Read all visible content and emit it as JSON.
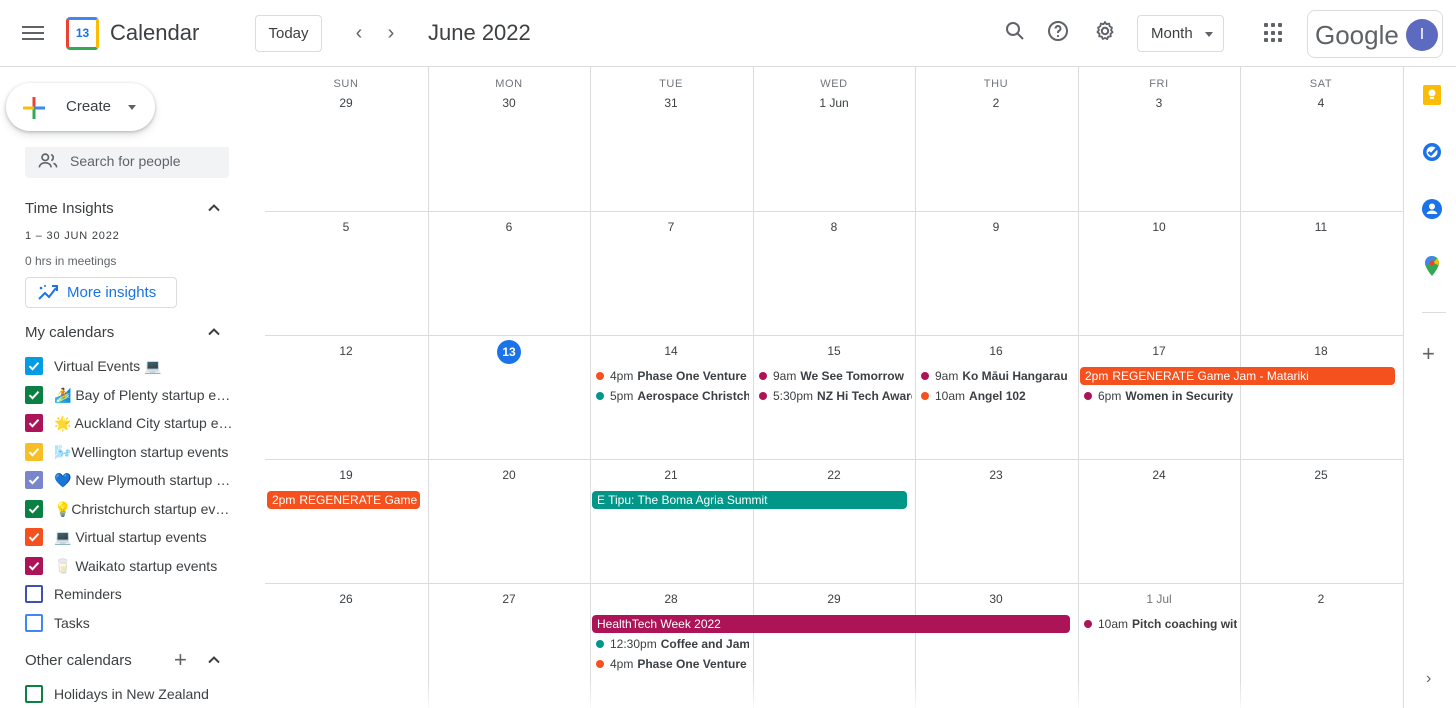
{
  "header": {
    "app_title": "Calendar",
    "logo_day": "13",
    "today_label": "Today",
    "prev_icon": "‹",
    "next_icon": "›",
    "month_title": "June 2022",
    "view_label": "Month",
    "brand": "Google",
    "avatar_initial": "I"
  },
  "sidebar": {
    "create_label": "Create",
    "search_people_placeholder": "Search for people",
    "time_insights": {
      "heading": "Time Insights",
      "date_range": "1 – 30 JUN 2022",
      "meetings": "0 hrs in meetings",
      "more_insights": "More insights"
    },
    "my_calendars_heading": "My calendars",
    "my_calendars": [
      {
        "label": "Virtual Events 💻",
        "color": "#039be5",
        "checked": true
      },
      {
        "label": "🏄 Bay of Plenty startup events",
        "color": "#0b8043",
        "checked": true
      },
      {
        "label": "🌟 Auckland City startup events",
        "color": "#ad1457",
        "checked": true
      },
      {
        "label": "🌬️Wellington startup events",
        "color": "#f6bf26",
        "checked": true
      },
      {
        "label": "💙 New Plymouth startup events",
        "color": "#7986cb",
        "checked": true
      },
      {
        "label": "💡Christchurch startup events",
        "color": "#0b8043",
        "checked": true
      },
      {
        "label": "💻 Virtual startup events",
        "color": "#f4511e",
        "checked": true
      },
      {
        "label": "🥛 Waikato startup events",
        "color": "#ad1457",
        "checked": true
      },
      {
        "label": "Reminders",
        "color": "#3f51b5",
        "checked": false
      },
      {
        "label": "Tasks",
        "color": "#4285f4",
        "checked": false
      }
    ],
    "other_calendars_heading": "Other calendars",
    "other_calendars": [
      {
        "label": "Holidays in New Zealand",
        "color": "#0b8043",
        "checked": false
      }
    ]
  },
  "calendar": {
    "weekdays": [
      "SUN",
      "MON",
      "TUE",
      "WED",
      "THU",
      "FRI",
      "SAT"
    ],
    "weeks": [
      [
        "29",
        "30",
        "31",
        "1 Jun",
        "2",
        "3",
        "4"
      ],
      [
        "5",
        "6",
        "7",
        "8",
        "9",
        "10",
        "11"
      ],
      [
        "12",
        "13",
        "14",
        "15",
        "16",
        "17",
        "18"
      ],
      [
        "19",
        "20",
        "21",
        "22",
        "23",
        "24",
        "25"
      ],
      [
        "26",
        "27",
        "28",
        "29",
        "30",
        "1 Jul",
        "2"
      ]
    ],
    "today": {
      "week": 2,
      "day": 1
    },
    "timed_events": [
      {
        "week": 2,
        "day": 2,
        "slot": 0,
        "time": "4pm",
        "title": "Phase One Venture",
        "color": "#f4511e"
      },
      {
        "week": 2,
        "day": 2,
        "slot": 1,
        "time": "5pm",
        "title": "Aerospace Christchurch",
        "color": "#009688"
      },
      {
        "week": 2,
        "day": 3,
        "slot": 0,
        "time": "9am",
        "title": "We See Tomorrow",
        "color": "#ad1457"
      },
      {
        "week": 2,
        "day": 3,
        "slot": 1,
        "time": "5:30pm",
        "title": "NZ Hi Tech Awards",
        "color": "#ad1457"
      },
      {
        "week": 2,
        "day": 4,
        "slot": 0,
        "time": "9am",
        "title": "Ko Māui Hangarau",
        "color": "#ad1457"
      },
      {
        "week": 2,
        "day": 4,
        "slot": 1,
        "time": "10am",
        "title": "Angel 102",
        "color": "#f4511e"
      },
      {
        "week": 2,
        "day": 5,
        "slot": 1,
        "time": "6pm",
        "title": "Women in Security",
        "color": "#ad1457"
      },
      {
        "week": 4,
        "day": 2,
        "slot": 1,
        "time": "12:30pm",
        "title": "Coffee and Jam",
        "color": "#009688"
      },
      {
        "week": 4,
        "day": 2,
        "slot": 2,
        "time": "4pm",
        "title": "Phase One Venture",
        "color": "#f4511e"
      },
      {
        "week": 4,
        "day": 5,
        "slot": 0,
        "time": "10am",
        "title": "Pitch coaching with",
        "color": "#ad1457"
      }
    ],
    "bar_events": [
      {
        "week": 2,
        "day": 5,
        "span": 2,
        "slot": 0,
        "time": "2pm",
        "title": "REGENERATE Game Jam - Matariki",
        "color": "#f4511e"
      },
      {
        "week": 3,
        "day": 0,
        "span": 1,
        "slot": 0,
        "time": "2pm",
        "title": "REGENERATE Game Jam - Matariki",
        "color": "#f4511e"
      },
      {
        "week": 3,
        "day": 2,
        "span": 2,
        "slot": 0,
        "time": "",
        "title": "E Tipu: The Boma Agria Summit",
        "color": "#009688"
      },
      {
        "week": 4,
        "day": 2,
        "span": 3,
        "slot": 0,
        "time": "",
        "title": "HealthTech Week 2022",
        "color": "#ad1457"
      }
    ]
  },
  "rail": {
    "keep_color": "#fbbc04",
    "tasks_color": "#1a73e8",
    "contacts_color": "#1a73e8"
  }
}
